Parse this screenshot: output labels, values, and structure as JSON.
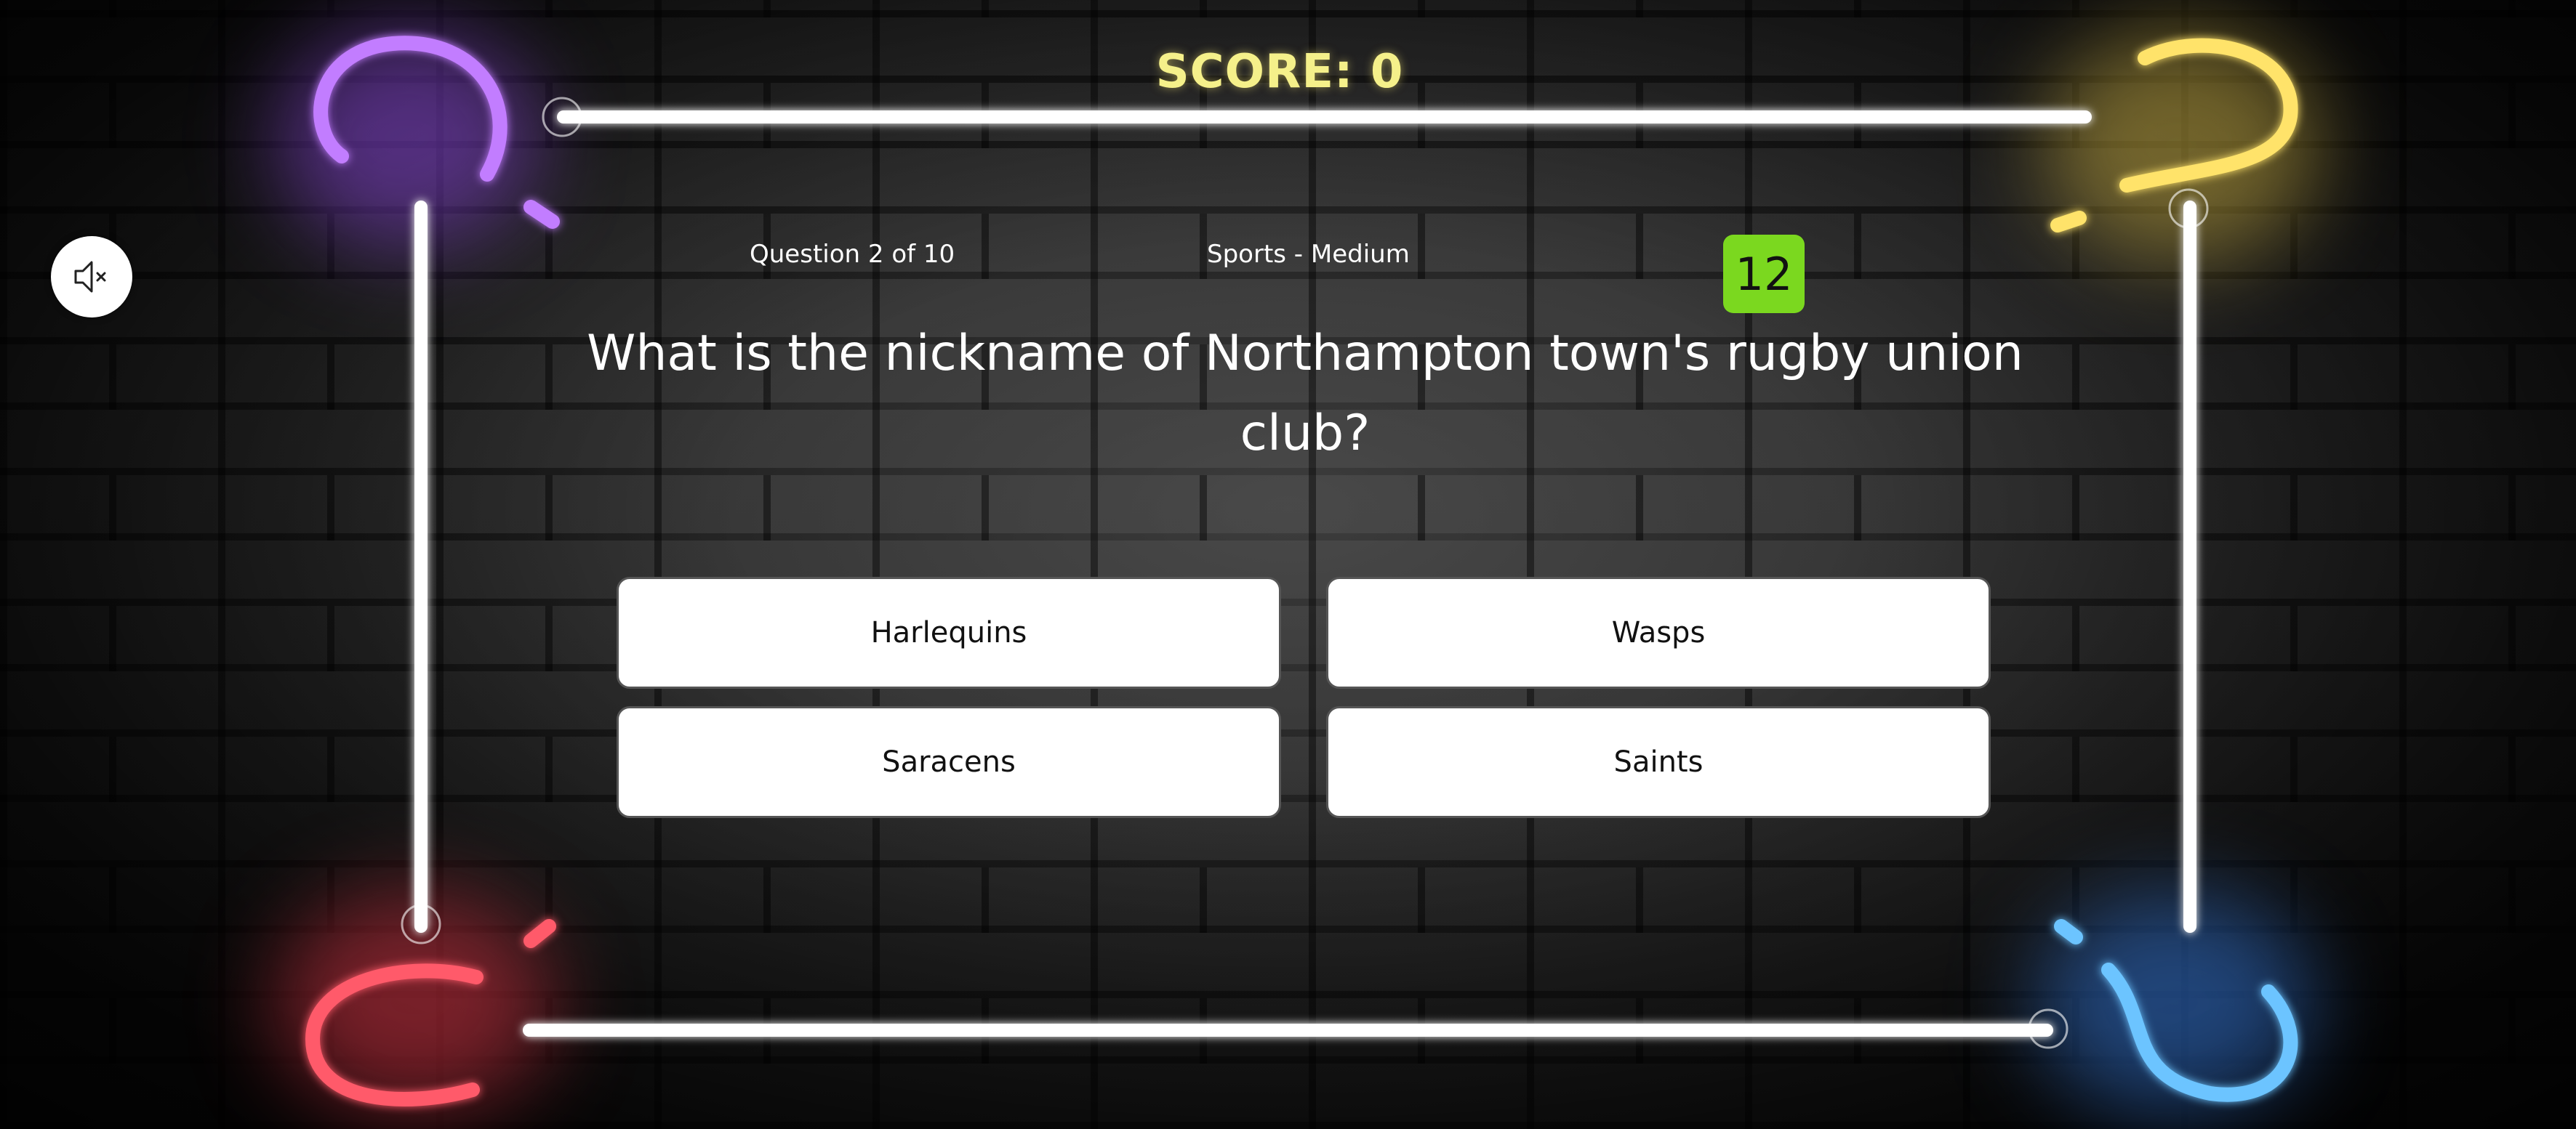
{
  "header": {
    "score_text": "SCORE: 0"
  },
  "controls": {
    "mute_icon": "speaker-muted-icon"
  },
  "quiz": {
    "progress_text": "Question 2 of 10",
    "category_text": "Sports - Medium",
    "timer_value": "12",
    "question_text": "What is the nickname of Northampton town's rugby union club?",
    "answers": [
      {
        "label": "Harlequins"
      },
      {
        "label": "Wasps"
      },
      {
        "label": "Saracens"
      },
      {
        "label": "Saints"
      }
    ]
  },
  "colors": {
    "timer_bg": "#7bd81f",
    "score_text": "#f5f08a",
    "neon_purple": "#b86bff",
    "neon_yellow": "#ffe36a",
    "neon_red": "#ff5a6a",
    "neon_blue": "#5ab8ff",
    "neon_white": "#ffffff"
  }
}
